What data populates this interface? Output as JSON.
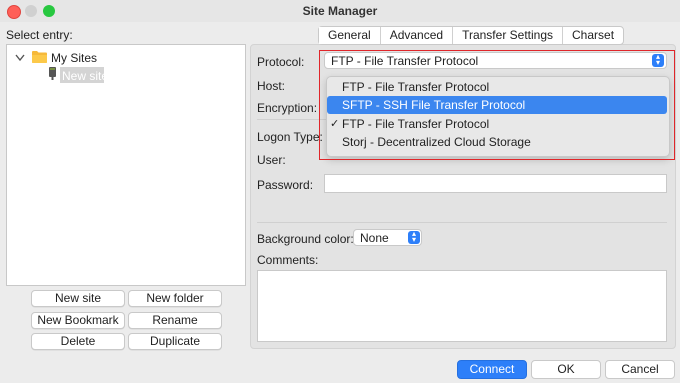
{
  "window": {
    "title": "Site Manager"
  },
  "left": {
    "select_entry_label": "Select entry:",
    "tree": {
      "root": "My Sites",
      "child": "New site"
    },
    "buttons": [
      "New site",
      "New folder",
      "New Bookmark",
      "Rename",
      "Delete",
      "Duplicate"
    ]
  },
  "tabs": [
    "General",
    "Advanced",
    "Transfer Settings",
    "Charset"
  ],
  "form": {
    "protocol_label": "Protocol:",
    "protocol_value": "FTP - File Transfer Protocol",
    "host_label": "Host:",
    "encryption_label": "Encryption:",
    "logon_type_label": "Logon Type:",
    "user_label": "User:",
    "password_label": "Password:",
    "background_color_label": "Background color:",
    "background_color_value": "None",
    "comments_label": "Comments:"
  },
  "dropdown": {
    "items": [
      {
        "label": "FTP - File Transfer Protocol",
        "checked": false,
        "highlighted": false
      },
      {
        "label": "SFTP - SSH File Transfer Protocol",
        "checked": false,
        "highlighted": true
      },
      {
        "label": "FTP - File Transfer Protocol",
        "checked": true,
        "highlighted": false
      },
      {
        "label": "Storj - Decentralized Cloud Storage",
        "checked": false,
        "highlighted": false
      }
    ],
    "check_glyph": "✓"
  },
  "footer": {
    "connect": "Connect",
    "ok": "OK",
    "cancel": "Cancel"
  },
  "colors": {
    "accent": "#2d7ff9",
    "highlight": "#3b86ef",
    "annotation": "#e0262a"
  }
}
